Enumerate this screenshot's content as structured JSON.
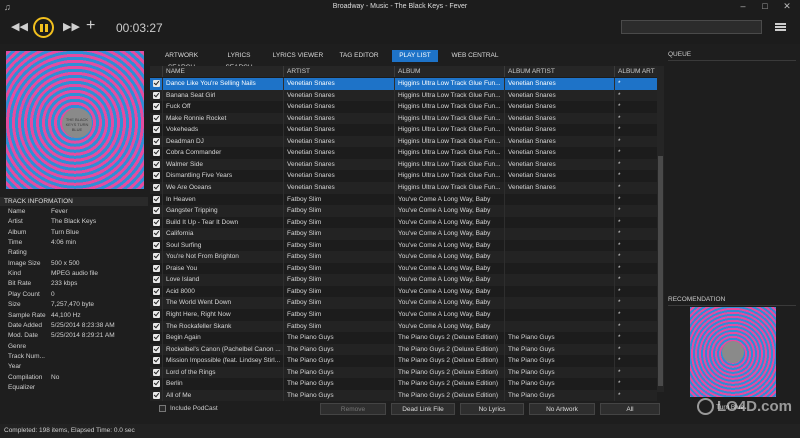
{
  "window": {
    "title": "Broadway - Music - The Black Keys - Fever",
    "app_icon": "music-note-icon"
  },
  "transport": {
    "elapsed": "00:03:27"
  },
  "track_info": {
    "header": "TRACK INFORMATION",
    "rows": [
      {
        "key": "Name",
        "value": "Fever"
      },
      {
        "key": "Artist",
        "value": "The Black Keys"
      },
      {
        "key": "Album",
        "value": "Turn Blue"
      },
      {
        "key": "Time",
        "value": "4:06 min"
      },
      {
        "key": "Rating",
        "value": ""
      },
      {
        "key": "Image Size",
        "value": "500 x 500"
      },
      {
        "key": "Kind",
        "value": "MPEG audio file"
      },
      {
        "key": "Bit Rate",
        "value": "233 kbps"
      },
      {
        "key": "Play Count",
        "value": "0"
      },
      {
        "key": "Size",
        "value": "7,257,470 byte"
      },
      {
        "key": "Sample Rate",
        "value": "44,100 Hz"
      },
      {
        "key": "Date Added",
        "value": "5/25/2014 8:23:38 AM"
      },
      {
        "key": "Mod. Date",
        "value": "5/25/2014 8:29:21 AM"
      },
      {
        "key": "Genre",
        "value": ""
      },
      {
        "key": "Track Num...",
        "value": ""
      },
      {
        "key": "Year",
        "value": ""
      },
      {
        "key": "Compilation",
        "value": "No"
      },
      {
        "key": "Equalizer",
        "value": ""
      }
    ]
  },
  "tabs": [
    "ARTWORK SEARCH",
    "LYRICS SEARCH",
    "LYRICS VIEWER",
    "TAG EDITOR",
    "PLAY LIST",
    "WEB CENTRAL"
  ],
  "active_tab": "PLAY LIST",
  "playlist": {
    "columns": [
      "NAME",
      "ARTIST",
      "ALBUM",
      "ALBUM ARTIST",
      "ALBUM ART"
    ],
    "rows": [
      {
        "name": "Dance Like You're Selling Nails",
        "artist": "Venetian Snares",
        "album": "Higgins Ultra Low Track Glue Fun...",
        "album_artist": "Venetian Snares",
        "art": "*"
      },
      {
        "name": "Banana Seat Girl",
        "artist": "Venetian Snares",
        "album": "Higgins Ultra Low Track Glue Fun...",
        "album_artist": "Venetian Snares",
        "art": "*"
      },
      {
        "name": "Fuck Off",
        "artist": "Venetian Snares",
        "album": "Higgins Ultra Low Track Glue Fun...",
        "album_artist": "Venetian Snares",
        "art": "*"
      },
      {
        "name": "Make Ronnie Rocket",
        "artist": "Venetian Snares",
        "album": "Higgins Ultra Low Track Glue Fun...",
        "album_artist": "Venetian Snares",
        "art": "*"
      },
      {
        "name": "Vokeheads",
        "artist": "Venetian Snares",
        "album": "Higgins Ultra Low Track Glue Fun...",
        "album_artist": "Venetian Snares",
        "art": "*"
      },
      {
        "name": "Deadman DJ",
        "artist": "Venetian Snares",
        "album": "Higgins Ultra Low Track Glue Fun...",
        "album_artist": "Venetian Snares",
        "art": "*"
      },
      {
        "name": "Cobra Commander",
        "artist": "Venetian Snares",
        "album": "Higgins Ultra Low Track Glue Fun...",
        "album_artist": "Venetian Snares",
        "art": "*"
      },
      {
        "name": "Walmer Side",
        "artist": "Venetian Snares",
        "album": "Higgins Ultra Low Track Glue Fun...",
        "album_artist": "Venetian Snares",
        "art": "*"
      },
      {
        "name": "Dismantling Five Years",
        "artist": "Venetian Snares",
        "album": "Higgins Ultra Low Track Glue Fun...",
        "album_artist": "Venetian Snares",
        "art": "*"
      },
      {
        "name": "We Are Oceans",
        "artist": "Venetian Snares",
        "album": "Higgins Ultra Low Track Glue Fun...",
        "album_artist": "Venetian Snares",
        "art": "*"
      },
      {
        "name": "In Heaven",
        "artist": "Fatboy Slim",
        "album": "You've Come A Long Way, Baby",
        "album_artist": "",
        "art": "*"
      },
      {
        "name": "Gangster Tripping",
        "artist": "Fatboy Slim",
        "album": "You've Come A Long Way, Baby",
        "album_artist": "",
        "art": "*"
      },
      {
        "name": "Build It Up - Tear It Down",
        "artist": "Fatboy Slim",
        "album": "You've Come A Long Way, Baby",
        "album_artist": "",
        "art": "*"
      },
      {
        "name": "California",
        "artist": "Fatboy Slim",
        "album": "You've Come A Long Way, Baby",
        "album_artist": "",
        "art": "*"
      },
      {
        "name": "Soul Surfing",
        "artist": "Fatboy Slim",
        "album": "You've Come A Long Way, Baby",
        "album_artist": "",
        "art": "*"
      },
      {
        "name": "You're Not From Brighton",
        "artist": "Fatboy Slim",
        "album": "You've Come A Long Way, Baby",
        "album_artist": "",
        "art": "*"
      },
      {
        "name": "Praise You",
        "artist": "Fatboy Slim",
        "album": "You've Come A Long Way, Baby",
        "album_artist": "",
        "art": "*"
      },
      {
        "name": "Love Island",
        "artist": "Fatboy Slim",
        "album": "You've Come A Long Way, Baby",
        "album_artist": "",
        "art": "*"
      },
      {
        "name": "Acid 8000",
        "artist": "Fatboy Slim",
        "album": "You've Come A Long Way, Baby",
        "album_artist": "",
        "art": "*"
      },
      {
        "name": "The World Went Down",
        "artist": "Fatboy Slim",
        "album": "You've Come A Long Way, Baby",
        "album_artist": "",
        "art": "*"
      },
      {
        "name": "Right Here, Right Now",
        "artist": "Fatboy Slim",
        "album": "You've Come A Long Way, Baby",
        "album_artist": "",
        "art": "*"
      },
      {
        "name": "The Rockafeller Skank",
        "artist": "Fatboy Slim",
        "album": "You've Come A Long Way, Baby",
        "album_artist": "",
        "art": "*"
      },
      {
        "name": "Begin Again",
        "artist": "The Piano Guys",
        "album": "The Piano Guys 2 (Deluxe Edition)",
        "album_artist": "The Piano Guys",
        "art": "*"
      },
      {
        "name": "Rockelbel's Canon (Pachelbel Canon ...",
        "artist": "The Piano Guys",
        "album": "The Piano Guys 2 (Deluxe Edition)",
        "album_artist": "The Piano Guys",
        "art": "*"
      },
      {
        "name": "Mission Impossible (feat. Lindsey Stirl...",
        "artist": "The Piano Guys",
        "album": "The Piano Guys 2 (Deluxe Edition)",
        "album_artist": "The Piano Guys",
        "art": "*"
      },
      {
        "name": "Lord of the Rings",
        "artist": "The Piano Guys",
        "album": "The Piano Guys 2 (Deluxe Edition)",
        "album_artist": "The Piano Guys",
        "art": "*"
      },
      {
        "name": "Berlin",
        "artist": "The Piano Guys",
        "album": "The Piano Guys 2 (Deluxe Edition)",
        "album_artist": "The Piano Guys",
        "art": "*"
      },
      {
        "name": "All of Me",
        "artist": "The Piano Guys",
        "album": "The Piano Guys 2 (Deluxe Edition)",
        "album_artist": "The Piano Guys",
        "art": "*"
      }
    ]
  },
  "bottom": {
    "include_podcast": "Include PodCast",
    "remove": "Remove",
    "dead_link": "Dead Link File",
    "no_lyrics": "No Lyrics",
    "no_artwork": "No Artwork",
    "all": "All"
  },
  "queue": {
    "header": "QUEUE"
  },
  "recommendation": {
    "header": "RECOMENDATION",
    "caption": "Turn Blue"
  },
  "album_art_label": "THE BLACK KEYS TURN BLUE",
  "status": "Completed: 198 items, Elapsed Time: 0.0 sec",
  "watermark": "LO4D.com",
  "colors": {
    "accent": "#1e73c8",
    "play_button": "#f2c01e",
    "art_pink": "#e64ba0",
    "art_blue": "#2f8ed6"
  }
}
